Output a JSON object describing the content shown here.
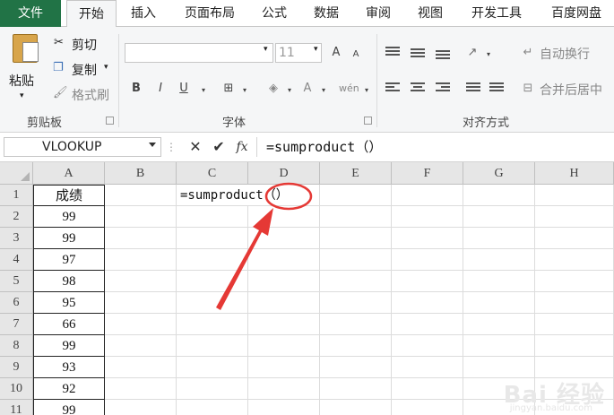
{
  "ribbon_tabs": [
    "文件",
    "开始",
    "插入",
    "页面布局",
    "公式",
    "数据",
    "审阅",
    "视图",
    "开发工具",
    "百度网盘"
  ],
  "clipboard": {
    "paste": "粘贴",
    "cut": "剪切",
    "copy": "复制",
    "format_painter": "格式刷",
    "group_label": "剪贴板"
  },
  "font": {
    "size": "11",
    "group_label": "字体"
  },
  "alignment": {
    "wrap_text": "自动换行",
    "merge_center": "合并后居中",
    "group_label": "对齐方式"
  },
  "formula_bar": {
    "name_box": "VLOOKUP",
    "fx": "fx",
    "formula": "=sumproduct（）"
  },
  "columns": [
    "A",
    "B",
    "C",
    "D",
    "E",
    "F",
    "G",
    "H"
  ],
  "rows": [
    "1",
    "2",
    "3",
    "4",
    "5",
    "6",
    "7",
    "8",
    "9",
    "10",
    "11"
  ],
  "column_A": [
    "成绩",
    "99",
    "99",
    "97",
    "98",
    "95",
    "66",
    "99",
    "93",
    "92",
    "99"
  ],
  "cell_C1": "=sumproduct（）",
  "annotation_color": "#e53935",
  "watermark": {
    "text": "Bai 经验",
    "url": "jingyan.baidu.com"
  }
}
